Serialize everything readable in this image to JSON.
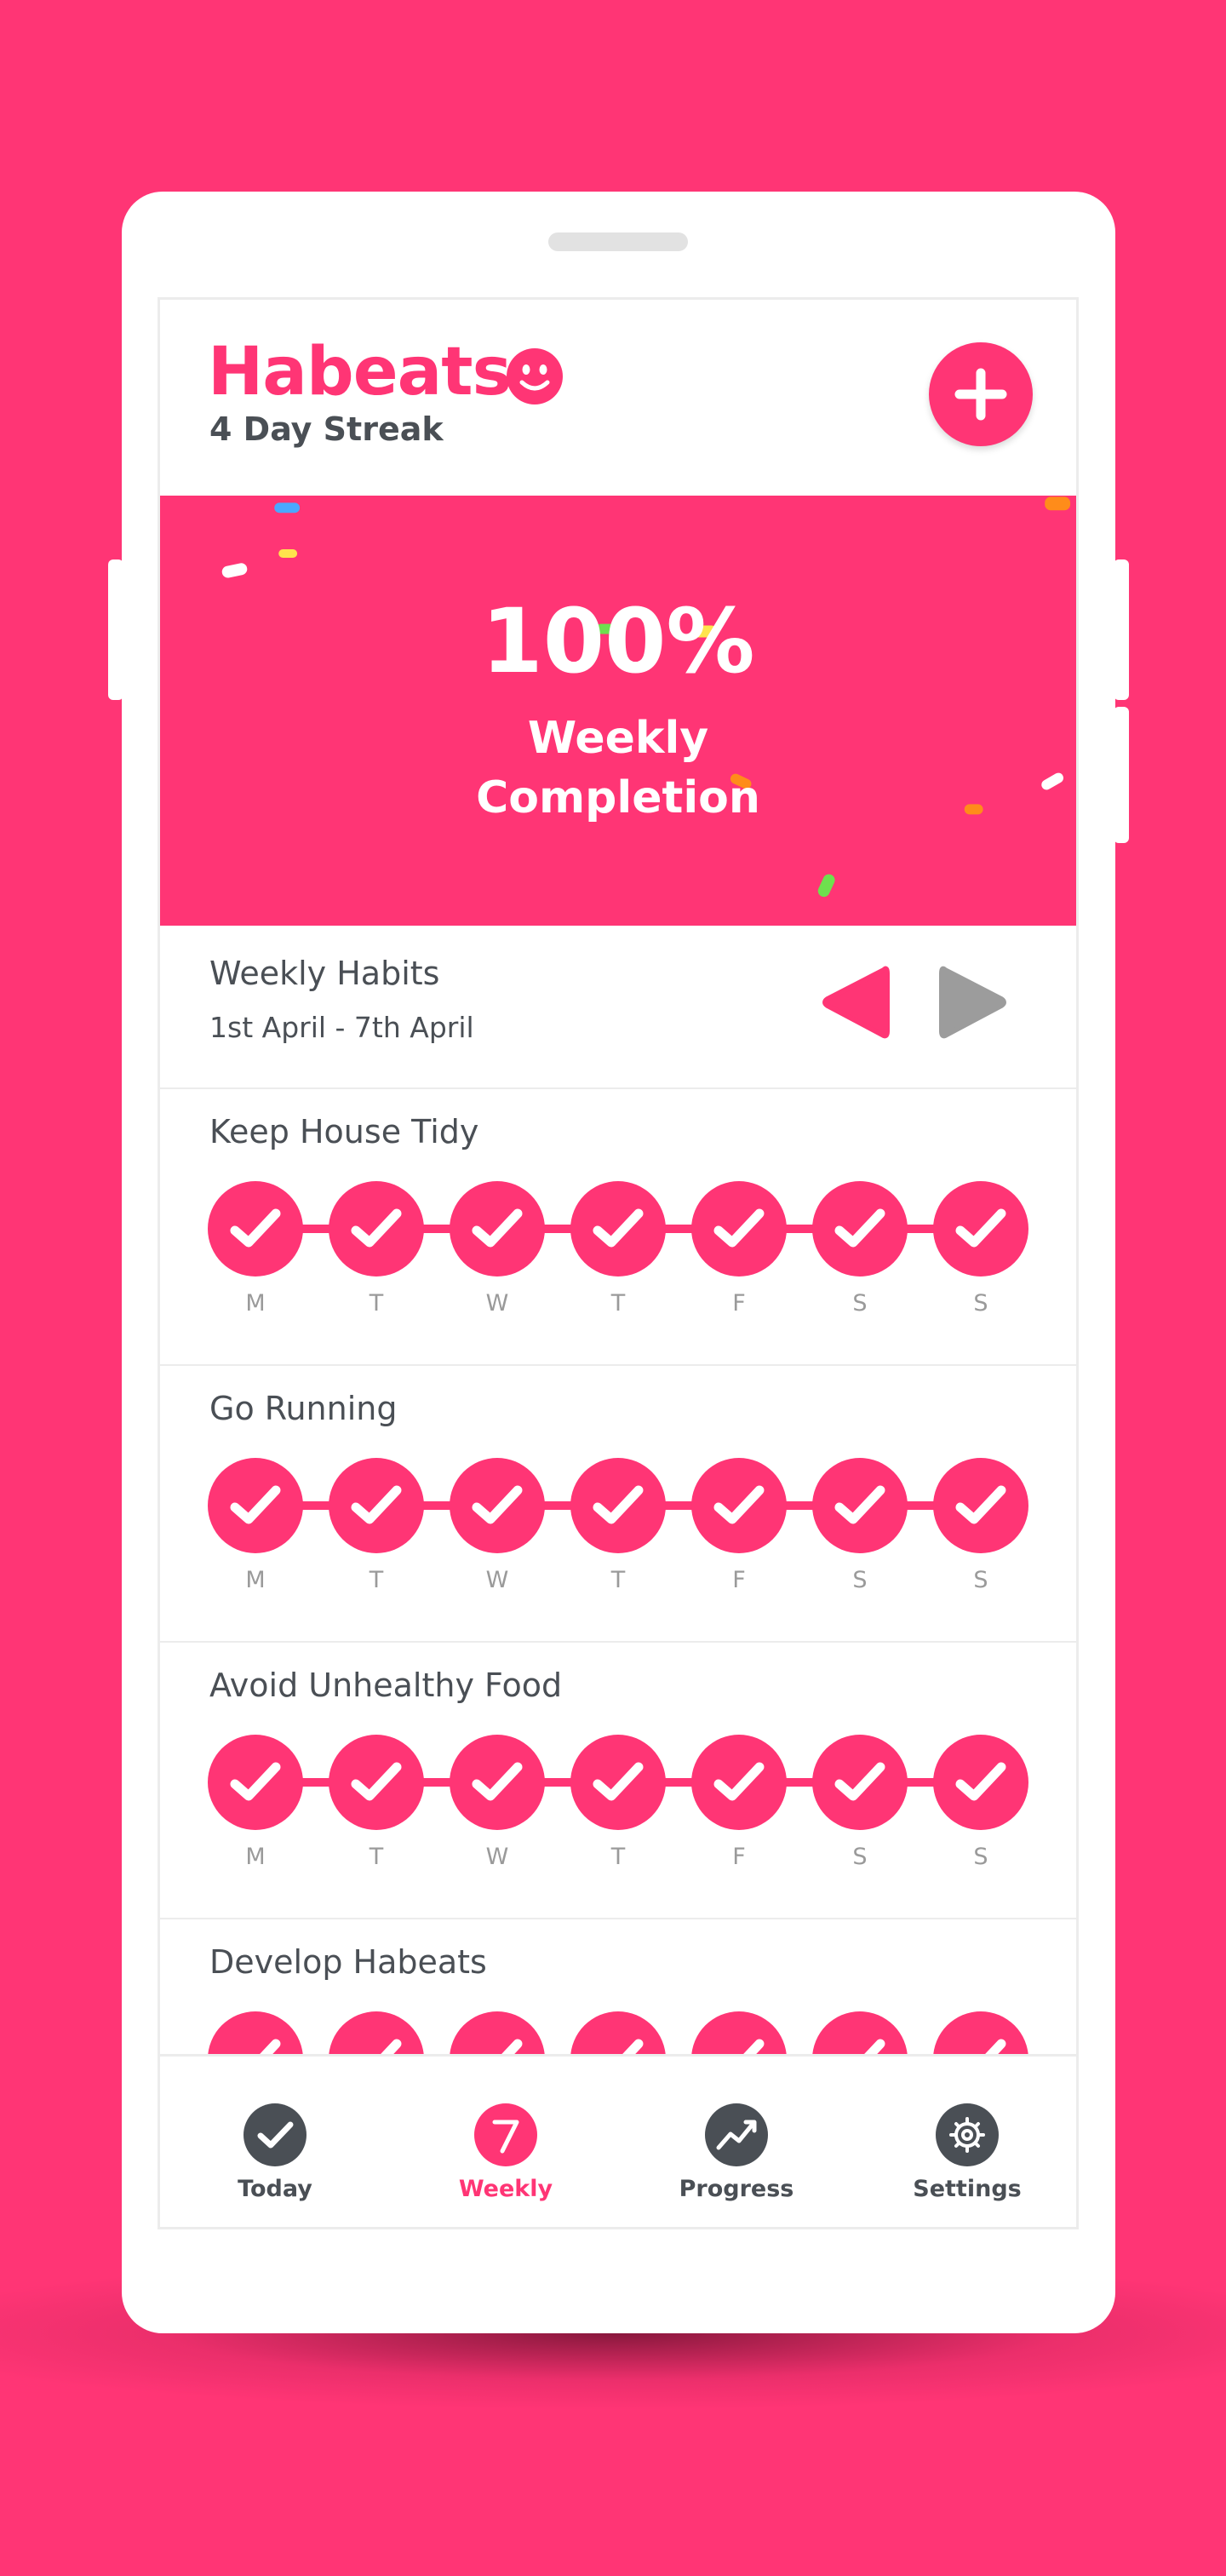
{
  "app": {
    "logo_text": "Habeats",
    "streak": "4 Day Streak",
    "add_button": "+"
  },
  "banner": {
    "percent": "100%",
    "caption_line1": "Weekly",
    "caption_line2": "Completion"
  },
  "week": {
    "title": "Weekly Habits",
    "range": "1st April - 7th April"
  },
  "days": [
    "M",
    "T",
    "W",
    "T",
    "F",
    "S",
    "S"
  ],
  "habits": [
    {
      "name": "Keep House Tidy",
      "completed": [
        true,
        true,
        true,
        true,
        true,
        true,
        true
      ]
    },
    {
      "name": "Go Running",
      "completed": [
        true,
        true,
        true,
        true,
        true,
        true,
        true
      ]
    },
    {
      "name": "Avoid Unhealthy Food",
      "completed": [
        true,
        true,
        true,
        true,
        true,
        true,
        true
      ]
    },
    {
      "name": "Develop Habeats",
      "completed": [
        true,
        true,
        true,
        true,
        true,
        true,
        true
      ]
    }
  ],
  "tabs": [
    {
      "label": "Today",
      "icon": "check-icon",
      "active": false
    },
    {
      "label": "Weekly",
      "icon": "seven-icon",
      "active": true
    },
    {
      "label": "Progress",
      "icon": "trend-icon",
      "active": false
    },
    {
      "label": "Settings",
      "icon": "gear-icon",
      "active": false
    }
  ],
  "colors": {
    "brand": "#ff3575",
    "text": "#4a4f55",
    "muted": "#9a9a9a",
    "inactive_arrow": "#9c9c9c"
  }
}
